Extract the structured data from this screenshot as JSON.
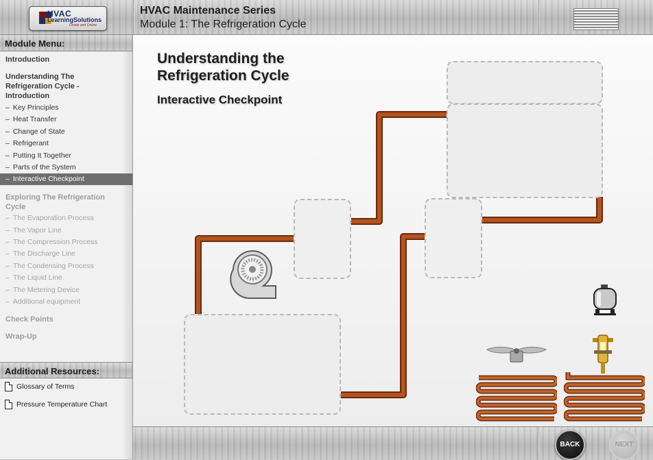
{
  "header": {
    "logo": {
      "line1": "HVAC",
      "line2": "LearningSolutions",
      "line3": "Onsite and Online"
    },
    "series_title": "HVAC Maintenance Series",
    "module_title": "Module 1: The Refrigeration Cycle"
  },
  "sidebar": {
    "menu_heading": "Module Menu:",
    "items": [
      {
        "label": "Introduction"
      },
      {
        "label": "Understanding The Refrigeration Cycle - Introduction"
      }
    ],
    "understanding_subitems": [
      {
        "label": "Key Principles"
      },
      {
        "label": "Heat Transfer"
      },
      {
        "label": "Change of State"
      },
      {
        "label": "Refrigerant"
      },
      {
        "label": "Putting It Together"
      },
      {
        "label": "Parts of the System"
      },
      {
        "label": "Interactive Checkpoint",
        "active": true
      }
    ],
    "exploring": {
      "label": "Exploring The Refrigeration Cycle"
    },
    "exploring_subitems": [
      {
        "label": "The Evaporation Process"
      },
      {
        "label": "The Vapor Line"
      },
      {
        "label": "The Compression Process"
      },
      {
        "label": "The Discharge Line"
      },
      {
        "label": "The Condensing Process"
      },
      {
        "label": "The Liquid Line"
      },
      {
        "label": "The Metering Device"
      },
      {
        "label": "Additional equipment"
      }
    ],
    "check_points": "Check Points",
    "wrap_up": "Wrap-Up",
    "resources_heading": "Additional Resources:",
    "resources": [
      {
        "label": "Glossary of Terms"
      },
      {
        "label": "Pressure Temperature Chart"
      }
    ]
  },
  "content": {
    "title": "Understanding the Refrigeration Cycle",
    "subtitle": "Interactive Checkpoint",
    "draggable_parts": [
      "blower-wheel",
      "compressor",
      "fan-blade",
      "metering-device",
      "coil",
      "coil"
    ]
  },
  "footer": {
    "back_label": "BACK",
    "next_label": "NEXT"
  },
  "colors": {
    "pipe": "#b5531f",
    "pipe_dark": "#6a2a0c",
    "active_menu_bg": "#6e6e6e"
  }
}
